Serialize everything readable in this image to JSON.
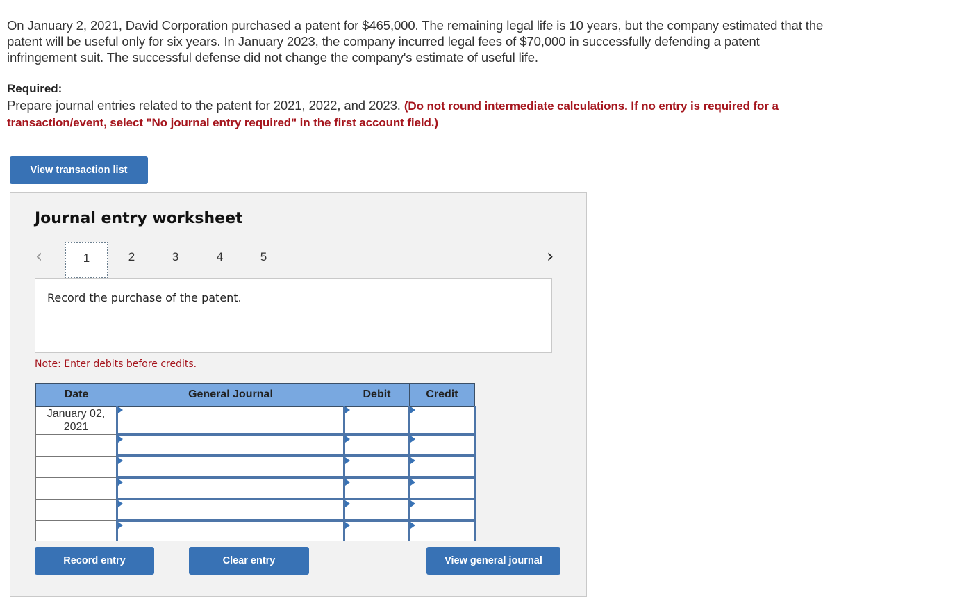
{
  "problem": {
    "text": "On January 2, 2021, David Corporation purchased a patent for $465,000. The remaining legal life is 10 years, but the company estimated that the patent will be useful only for six years. In January 2023, the company incurred legal fees of $70,000 in successfully defending a patent infringement suit. The successful defense did not change the company's estimate of useful life."
  },
  "required": {
    "label": "Required:",
    "text": "Prepare journal entries related to the patent for 2021, 2022, and 2023. ",
    "emphasis": "(Do not round intermediate calculations. If no entry is required for a transaction/event, select \"No journal entry required\" in the first account field.)"
  },
  "buttons": {
    "view_transaction_list": "View transaction list",
    "record_entry": "Record entry",
    "clear_entry": "Clear entry",
    "view_general_journal": "View general journal"
  },
  "worksheet": {
    "title": "Journal entry worksheet",
    "prev_icon": "‹",
    "next_icon": "›",
    "tabs": [
      {
        "label": "1",
        "active": true
      },
      {
        "label": "2",
        "active": false
      },
      {
        "label": "3",
        "active": false
      },
      {
        "label": "4",
        "active": false
      },
      {
        "label": "5",
        "active": false
      }
    ],
    "instruction": "Record the purchase of the patent.",
    "note": "Note: Enter debits before credits."
  },
  "journal": {
    "headers": {
      "date": "Date",
      "general_journal": "General Journal",
      "debit": "Debit",
      "credit": "Credit"
    },
    "rows": [
      {
        "date": "January 02, 2021",
        "account": "",
        "debit": "",
        "credit": ""
      },
      {
        "date": "",
        "account": "",
        "debit": "",
        "credit": ""
      },
      {
        "date": "",
        "account": "",
        "debit": "",
        "credit": ""
      },
      {
        "date": "",
        "account": "",
        "debit": "",
        "credit": ""
      },
      {
        "date": "",
        "account": "",
        "debit": "",
        "credit": ""
      },
      {
        "date": "",
        "account": "",
        "debit": "",
        "credit": ""
      }
    ]
  },
  "colors": {
    "button_blue": "#3872b5",
    "header_blue": "#79a8e0",
    "emphasis_red": "#a5151d"
  }
}
